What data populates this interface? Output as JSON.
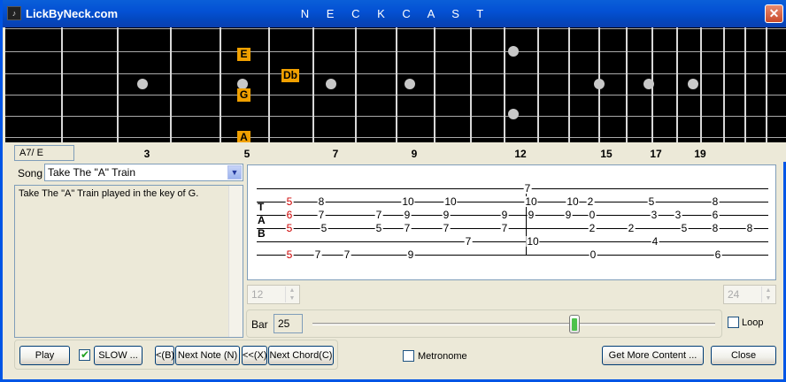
{
  "window": {
    "app_name": "LickByNeck.com",
    "title": "N E C K  C A S T",
    "close_glyph": "✕"
  },
  "fretboard": {
    "fret_numbers": [
      "3",
      "5",
      "7",
      "9",
      "12",
      "15",
      "17",
      "19"
    ],
    "notes": [
      {
        "label": "E"
      },
      {
        "label": "Db"
      },
      {
        "label": "G"
      },
      {
        "label": "A"
      }
    ]
  },
  "chord": "A7/ E",
  "song": {
    "label": "Song",
    "selected": "Take The \"A\" Train",
    "description": "Take The \"A\" Train played in the key of G."
  },
  "tab": {
    "clef": [
      "T",
      "A",
      "B"
    ],
    "notes": [
      [
        "5",
        0,
        true
      ],
      [
        "8",
        0,
        false
      ],
      [
        "10",
        0,
        false
      ],
      [
        "10",
        0,
        false
      ],
      [
        "7",
        -1,
        false
      ],
      [
        "10",
        0,
        false
      ],
      [
        "10",
        0,
        false
      ],
      [
        "2",
        0,
        false
      ],
      [
        "5",
        0,
        false
      ],
      [
        "8",
        0,
        false
      ],
      [
        "6",
        1,
        true
      ],
      [
        "7",
        1,
        false
      ],
      [
        "7",
        1,
        false
      ],
      [
        "9",
        1,
        false
      ],
      [
        "9",
        1,
        false
      ],
      [
        "9",
        1,
        false
      ],
      [
        "9",
        1,
        false
      ],
      [
        "9",
        1,
        false
      ],
      [
        "0",
        1,
        false
      ],
      [
        "3",
        1,
        false
      ],
      [
        "3",
        1,
        false
      ],
      [
        "6",
        1,
        false
      ],
      [
        "5",
        2,
        true
      ],
      [
        "5",
        2,
        false
      ],
      [
        "5",
        2,
        false
      ],
      [
        "7",
        2,
        false
      ],
      [
        "7",
        2,
        false
      ],
      [
        "7",
        2,
        false
      ],
      [
        "2",
        2,
        false
      ],
      [
        "2",
        2,
        false
      ],
      [
        "5",
        2,
        false
      ],
      [
        "8",
        2,
        false
      ],
      [
        "8",
        2,
        false
      ],
      [
        "7",
        3,
        false
      ],
      [
        "10",
        3,
        false
      ],
      [
        "4",
        3,
        false
      ],
      [
        "5",
        4,
        true
      ],
      [
        "7",
        4,
        false
      ],
      [
        "7",
        4,
        false
      ],
      [
        "9",
        4,
        false
      ],
      [
        "0",
        4,
        false
      ],
      [
        "6",
        4,
        false
      ]
    ]
  },
  "spin_left": {
    "value": "12"
  },
  "spin_right": {
    "value": "24"
  },
  "bar": {
    "label": "Bar",
    "value": "25",
    "position_fraction": 0.65
  },
  "loop": {
    "label": "Loop",
    "checked": false
  },
  "controls": {
    "play": "Play",
    "slow_checked": true,
    "slow": "SLOW ...",
    "prev_note": "<(B)",
    "next_note": "Next Note (N)",
    "prev_chord": "<<(X)",
    "next_chord": "Next Chord(C)"
  },
  "metronome": {
    "label": "Metronome",
    "checked": false
  },
  "get_more": "Get More Content ...",
  "close": "Close"
}
